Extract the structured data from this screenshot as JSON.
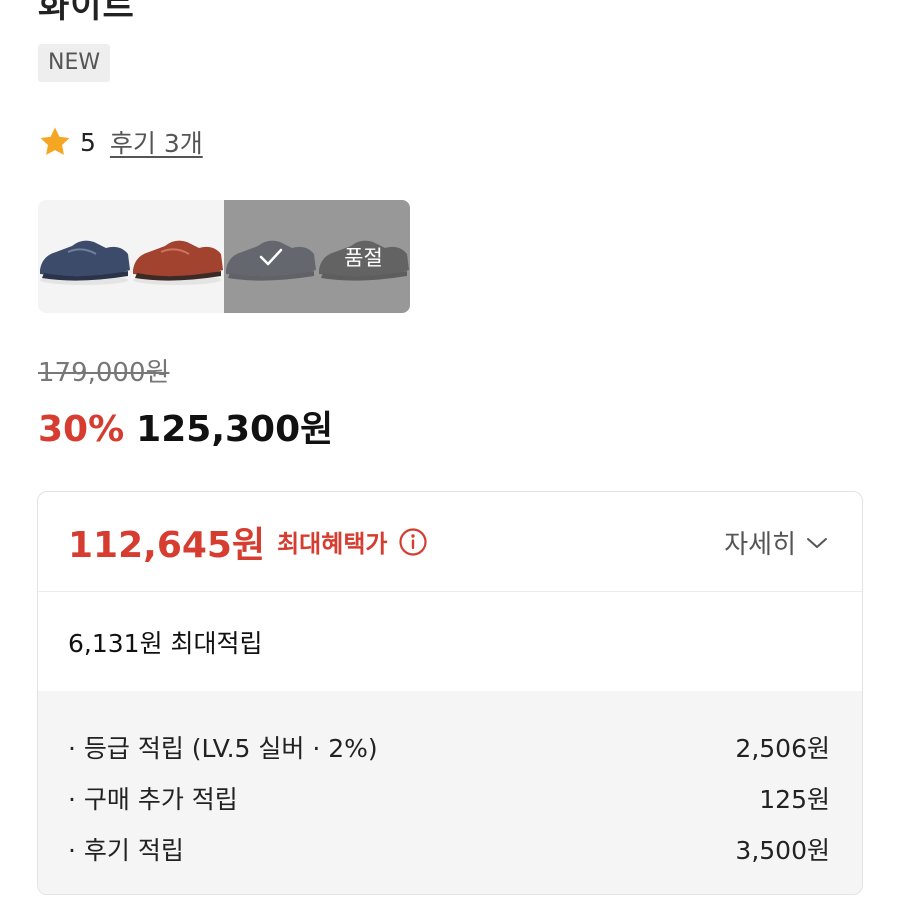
{
  "product": {
    "title_fragment": "화이트",
    "badge": "NEW"
  },
  "rating": {
    "score": "5",
    "review_link": "후기 3개"
  },
  "options": {
    "soldout_label": "품절",
    "items": [
      {
        "color": "navy"
      },
      {
        "color": "red"
      },
      {
        "color": "navy-selected"
      },
      {
        "color": "black-soldout"
      }
    ]
  },
  "price": {
    "original": "179,000원",
    "discount_percent": "30%",
    "sale": "125,300원"
  },
  "benefit": {
    "max_price": "112,645원",
    "max_label": "최대혜택가",
    "detail_label": "자세히",
    "max_points_summary": "6,131원 최대적립",
    "rows": [
      {
        "label": "· 등급 적립 (LV.5 실버 · 2%)",
        "value": "2,506원"
      },
      {
        "label": "· 구매 추가 적립",
        "value": "125원"
      },
      {
        "label": "· 후기 적립",
        "value": "3,500원"
      }
    ]
  },
  "colors": {
    "accent_red": "#d63d30",
    "star": "#f5a623"
  }
}
